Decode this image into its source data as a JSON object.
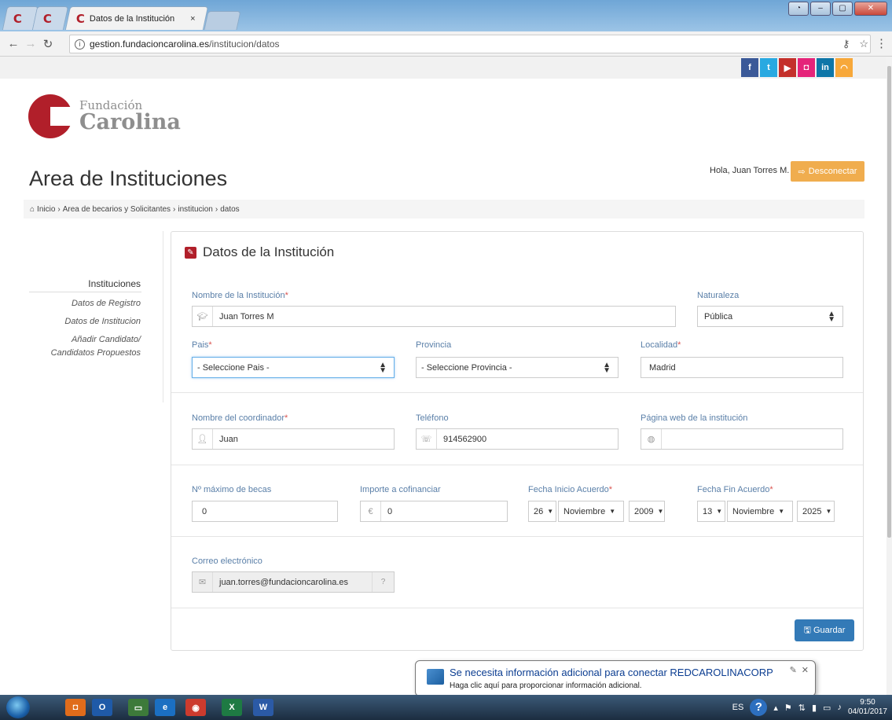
{
  "browser": {
    "tab_title": "Datos de la Institución",
    "tab_close": "×",
    "url_host": "gestion.fundacioncarolina.es",
    "url_path": "/institucion/datos"
  },
  "social": [
    "f",
    "t",
    "▶",
    "◘",
    "in",
    "◠"
  ],
  "logo": {
    "line1": "Fundación",
    "line2": "Carolina"
  },
  "header": {
    "title": "Area de Instituciones",
    "greeting": "Hola, Juan Torres M.",
    "logout_label": "Desconectar"
  },
  "breadcrumb": {
    "items": [
      "Inicio",
      "Area de becarios y Solicitantes",
      "institucion",
      "datos"
    ],
    "separator": "›"
  },
  "sidebar": {
    "title": "Instituciones",
    "items": [
      "Datos de Registro",
      "Datos de Institucion",
      "Añadir Candidato/",
      "Candidatos Propuestos"
    ]
  },
  "form": {
    "title": "Datos de la Institución",
    "nombre_label": "Nombre de la Institución",
    "nombre_value": "Juan Torres M",
    "naturaleza_label": "Naturaleza",
    "naturaleza_value": "Pública",
    "pais_label": "Pais",
    "pais_value": "- Seleccione Pais -",
    "provincia_label": "Provincia",
    "provincia_value": "- Seleccione Provincia -",
    "localidad_label": "Localidad",
    "localidad_value": "Madrid",
    "coordinador_label": "Nombre del coordinador",
    "coordinador_value": "Juan",
    "telefono_label": "Teléfono",
    "telefono_value": "914562900",
    "web_label": "Página web de la institución",
    "web_value": "",
    "becas_label": "Nº máximo de becas",
    "becas_value": "0",
    "importe_label": "Importe a cofinanciar",
    "importe_value": "0",
    "currency": "€",
    "inicio_label": "Fecha Inicio Acuerdo",
    "inicio_day": "26",
    "inicio_month": "Noviembre",
    "inicio_year": "2009",
    "fin_label": "Fecha Fin Acuerdo",
    "fin_day": "13",
    "fin_month": "Noviembre",
    "fin_year": "2025",
    "correo_label": "Correo electrónico",
    "correo_value": "juan.torres@fundacioncarolina.es",
    "required_mark": "*",
    "save_label": "Guardar"
  },
  "notification": {
    "title": "Se necesita información adicional para conectar REDCAROLINACORP",
    "text": "Haga clic aquí para proporcionar información adicional."
  },
  "taskbar": {
    "lang": "ES",
    "time": "9:50",
    "date": "04/01/2017"
  },
  "colors": {
    "brand": "#b11f2a",
    "label": "#5a7fa8",
    "logout": "#f0ad4e",
    "save": "#337ab7"
  }
}
